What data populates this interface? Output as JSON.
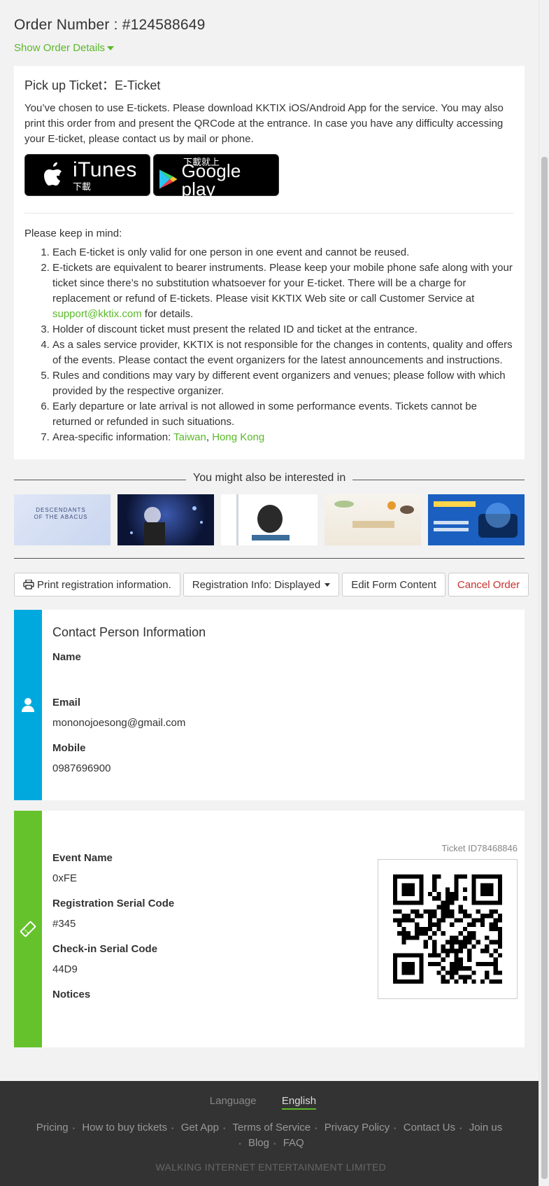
{
  "order": {
    "number_label": "Order Number : #124588649",
    "show_details_label": "Show Order Details"
  },
  "pickup": {
    "title": "Pick up Ticket：E-Ticket",
    "intro": "You’ve chosen to use E-tickets. Please download KKTIX iOS/Android App for the service. You may also print this order from and present the QRCode at the entrance. In case you have any difficulty accessing your E-ticket, please contact us by mail or phone.",
    "itunes_big": "iTunes",
    "itunes_small": "下載",
    "gplay_small": "下載就上",
    "gplay_big": "Google play",
    "keep_in_mind": "Please keep in mind:",
    "notes": {
      "n1": "Each E-ticket is only valid for one person in one event and cannot be reused.",
      "n2_a": "E-tickets are equivalent to bearer instruments. Please keep your mobile phone safe along with your ticket since there’s no substitution whatsoever for your E-ticket. There will be a charge for replacement or refund of E-tickets. Please visit KKTIX Web site or call Customer Service at ",
      "n2_link": "support@kktix.com",
      "n2_b": " for details.",
      "n3": "Holder of discount ticket must present the related ID and ticket at the entrance.",
      "n4": "As a sales service provider, KKTIX is not responsible for the changes in contents, quality and offers of the events. Please contact the event organizers for the latest announcements and instructions.",
      "n5": "Rules and conditions may vary by different event organizers and venues; please follow with which provided by the respective organizer.",
      "n6": "Early departure or late arrival is not allowed in some performance events. Tickets cannot be returned or refunded in such situations.",
      "n7_a": "Area-specific information: ",
      "n7_taiwan": "Taiwan",
      "n7_sep": ", ",
      "n7_hk": "Hong Kong"
    }
  },
  "interested": {
    "label": "You might also be interested in",
    "t1_text": "DESCENDANTS\nOF THE ABACUS"
  },
  "actions": {
    "print": "Print registration information.",
    "reg_info": "Registration Info: Displayed",
    "edit": "Edit Form Content",
    "cancel": "Cancel Order"
  },
  "contact": {
    "title": "Contact Person Information",
    "name_label": "Name",
    "name_value": "󠀠󠀠󠀠",
    "email_label": "Email",
    "email_value": "mononojoesong@gmail.com",
    "mobile_label": "Mobile",
    "mobile_value": "0987696900",
    "extra_value": "󠀠󠀠"
  },
  "ticket": {
    "title": "󠀠󠀠󠀠",
    "ticket_id": "Ticket ID78468846",
    "event_name_label": "Event Name",
    "event_name_value": "0xFE 󠀠󠀠󠀠󠀠",
    "reg_serial_label": "Registration Serial Code",
    "reg_serial_value": "#345",
    "checkin_label": "Check-in Serial Code",
    "checkin_value": "44D9",
    "notices_label": "Notices"
  },
  "footer": {
    "language_label": "Language",
    "lang_zh": "󠀠󠀠󠀠󠀠",
    "lang_en": "English",
    "lang_other": "󠀠󠀠󠀠",
    "links": [
      "Pricing",
      "How to buy tickets",
      "Get App",
      "Terms of Service",
      "Privacy Policy",
      "Contact Us",
      "Join us",
      "Blog",
      "FAQ"
    ],
    "copyright": "󠀠󠀠󠀠󠀠󠀠󠀠󠀠󠀠󠀠󠀠󠀠 WALKING INTERNET ENTERTAINMENT LIMITED"
  },
  "colors": {
    "accent": "#5bb82a",
    "contact_side": "#00a9dd",
    "ticket_side": "#65c22c",
    "danger": "#c9302c",
    "footer_bg": "#333333"
  },
  "icons": {
    "caret": "chevron-down-icon",
    "print": "printer-icon",
    "user": "user-icon",
    "ticket": "ticket-icon",
    "apple": "apple-icon",
    "play": "google-play-icon",
    "qr": "qr-code"
  }
}
